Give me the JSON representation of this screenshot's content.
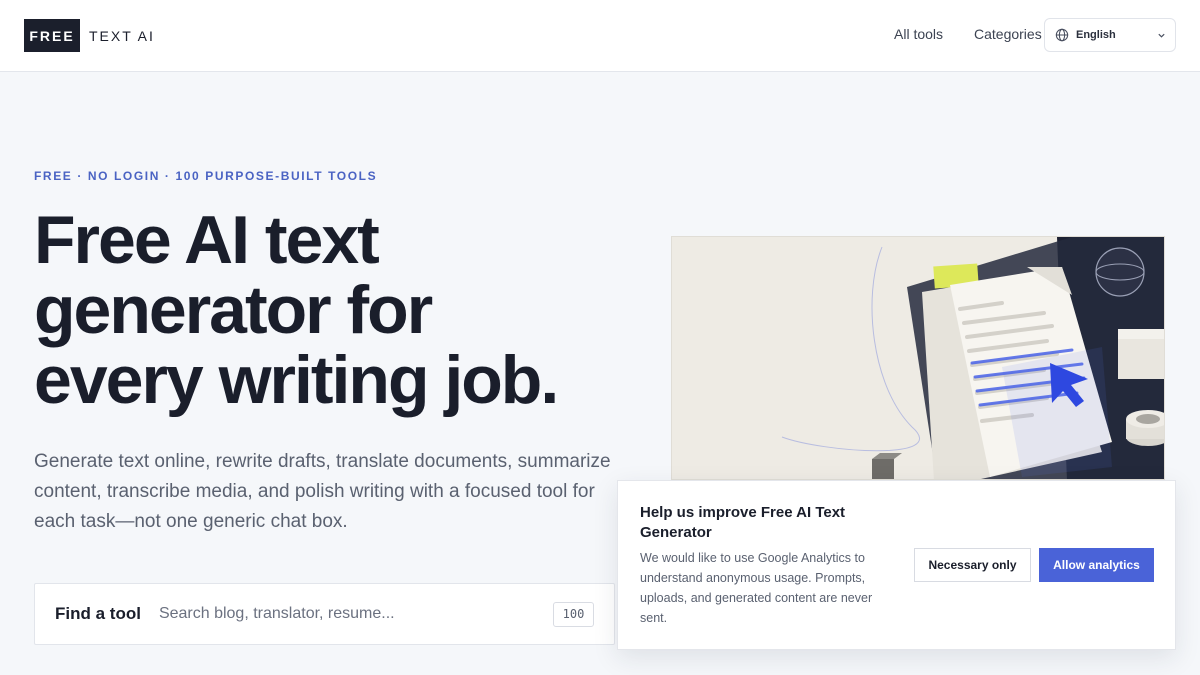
{
  "header": {
    "logo_box": "FREE",
    "logo_text": "TEXT AI",
    "nav": [
      "All tools",
      "Categories"
    ],
    "language": "English",
    "icons": {
      "language": "globe-icon",
      "dropdown": "chevron-down-icon"
    }
  },
  "hero": {
    "eyebrow": "FREE · NO LOGIN · 100 PURPOSE-BUILT TOOLS",
    "headline": [
      "Free AI text",
      "generator for",
      "every writing job."
    ],
    "subtext": "Generate text online, rewrite drafts, translate documents, summarize content, transcribe media, and polish writing with a focused tool for each task—not one generic chat box."
  },
  "search": {
    "label": "Find a tool",
    "placeholder": "Search blog, translator, resume...",
    "value": "",
    "count": "100"
  },
  "consent": {
    "title": "Help us improve Free AI Text Generator",
    "text": "We would like to use Google Analytics to understand anonymous usage. Prompts, uploads, and generated content are never sent.",
    "necessary_label": "Necessary only",
    "allow_label": "Allow analytics"
  },
  "colors": {
    "accent": "#4a63d8",
    "eyebrow": "#4a63c3",
    "logo_bg": "#1b1f2c",
    "background": "#f5f7fa"
  }
}
